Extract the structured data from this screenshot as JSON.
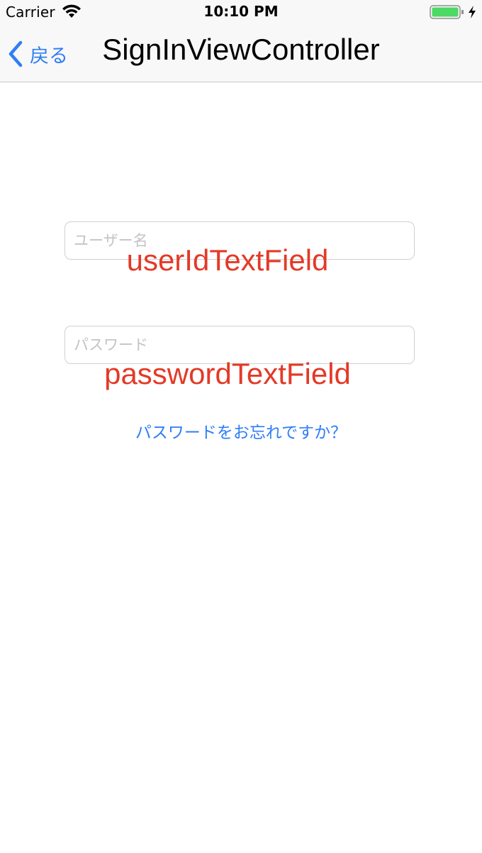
{
  "status_bar": {
    "carrier": "Carrier",
    "time": "10:10 PM",
    "icons": [
      "wifi-icon",
      "battery-icon",
      "charging-icon"
    ]
  },
  "nav_bar": {
    "back_label": "戻る",
    "title": "SignInViewController"
  },
  "form": {
    "user_id_placeholder": "ユーザー名",
    "user_id_value": "",
    "user_id_overlay": "userIdTextField",
    "password_placeholder": "パスワード",
    "password_value": "",
    "password_overlay": "passwordTextField",
    "forgot_password_label": "パスワードをお忘れですか？"
  },
  "colors": {
    "accent": "#2f7ef6",
    "overlay_red": "#e33a27",
    "battery_green": "#4cd964",
    "nav_background": "#f8f8f8"
  }
}
